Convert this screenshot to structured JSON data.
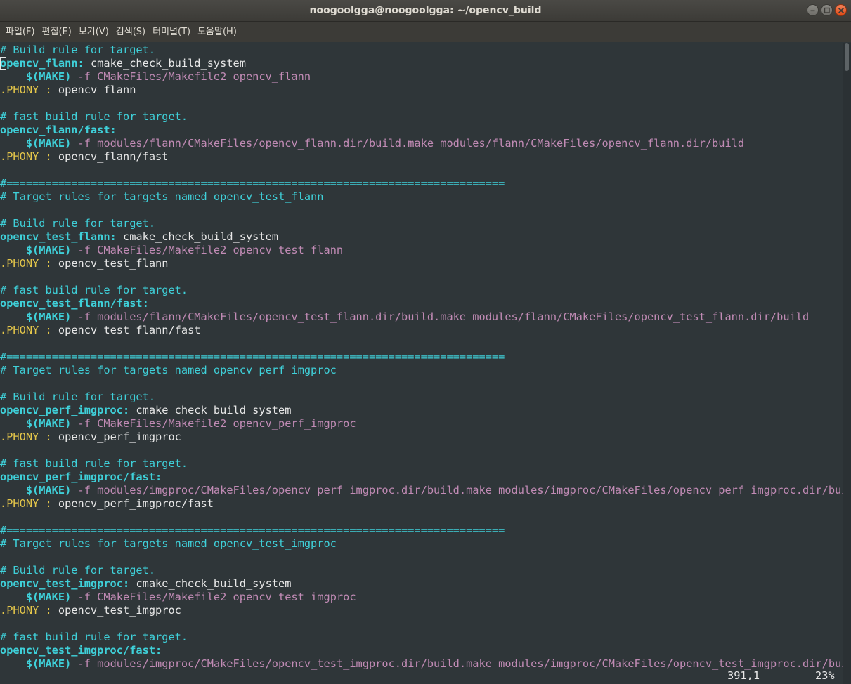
{
  "window": {
    "title": "noogoolgga@noogoolgga: ~/opencv_build"
  },
  "menu": [
    "파일(F)",
    "편집(E)",
    "보기(V)",
    "검색(S)",
    "터미널(T)",
    "도움말(H)"
  ],
  "lines": [
    [
      {
        "t": "# Build rule for target.",
        "c": "comment"
      }
    ],
    [
      {
        "t": "o",
        "c": "target",
        "cursor": true
      },
      {
        "t": "pencv_flann:",
        "c": "target"
      },
      {
        "t": " cmake_check_build_system",
        "c": "plain"
      }
    ],
    [
      {
        "t": "    ",
        "c": "plain"
      },
      {
        "t": "$(MAKE)",
        "c": "make"
      },
      {
        "t": " -f CMakeFiles/Makefile2 opencv_flann",
        "c": "args"
      }
    ],
    [
      {
        "t": ".PHONY",
        "c": "phony"
      },
      {
        "t": " ",
        "c": "plain"
      },
      {
        "t": ":",
        "c": "phony"
      },
      {
        "t": " opencv_flann",
        "c": "plain"
      }
    ],
    [],
    [
      {
        "t": "# fast build rule for target.",
        "c": "comment"
      }
    ],
    [
      {
        "t": "opencv_flann/fast:",
        "c": "target"
      }
    ],
    [
      {
        "t": "    ",
        "c": "plain"
      },
      {
        "t": "$(MAKE)",
        "c": "make"
      },
      {
        "t": " -f modules/flann/CMakeFiles/opencv_flann.dir/build.make modules/flann/CMakeFiles/opencv_flann.dir/build",
        "c": "args"
      }
    ],
    [
      {
        "t": ".PHONY",
        "c": "phony"
      },
      {
        "t": " ",
        "c": "plain"
      },
      {
        "t": ":",
        "c": "phony"
      },
      {
        "t": " opencv_flann/fast",
        "c": "plain"
      }
    ],
    [],
    [
      {
        "t": "#=============================================================================",
        "c": "comment"
      }
    ],
    [
      {
        "t": "# Target rules for targets named opencv_test_flann",
        "c": "comment"
      }
    ],
    [],
    [
      {
        "t": "# Build rule for target.",
        "c": "comment"
      }
    ],
    [
      {
        "t": "opencv_test_flann:",
        "c": "target"
      },
      {
        "t": " cmake_check_build_system",
        "c": "plain"
      }
    ],
    [
      {
        "t": "    ",
        "c": "plain"
      },
      {
        "t": "$(MAKE)",
        "c": "make"
      },
      {
        "t": " -f CMakeFiles/Makefile2 opencv_test_flann",
        "c": "args"
      }
    ],
    [
      {
        "t": ".PHONY",
        "c": "phony"
      },
      {
        "t": " ",
        "c": "plain"
      },
      {
        "t": ":",
        "c": "phony"
      },
      {
        "t": " opencv_test_flann",
        "c": "plain"
      }
    ],
    [],
    [
      {
        "t": "# fast build rule for target.",
        "c": "comment"
      }
    ],
    [
      {
        "t": "opencv_test_flann/fast:",
        "c": "target"
      }
    ],
    [
      {
        "t": "    ",
        "c": "plain"
      },
      {
        "t": "$(MAKE)",
        "c": "make"
      },
      {
        "t": " -f modules/flann/CMakeFiles/opencv_test_flann.dir/build.make modules/flann/CMakeFiles/opencv_test_flann.dir/build",
        "c": "args"
      }
    ],
    [
      {
        "t": ".PHONY",
        "c": "phony"
      },
      {
        "t": " ",
        "c": "plain"
      },
      {
        "t": ":",
        "c": "phony"
      },
      {
        "t": " opencv_test_flann/fast",
        "c": "plain"
      }
    ],
    [],
    [
      {
        "t": "#=============================================================================",
        "c": "comment"
      }
    ],
    [
      {
        "t": "# Target rules for targets named opencv_perf_imgproc",
        "c": "comment"
      }
    ],
    [],
    [
      {
        "t": "# Build rule for target.",
        "c": "comment"
      }
    ],
    [
      {
        "t": "opencv_perf_imgproc:",
        "c": "target"
      },
      {
        "t": " cmake_check_build_system",
        "c": "plain"
      }
    ],
    [
      {
        "t": "    ",
        "c": "plain"
      },
      {
        "t": "$(MAKE)",
        "c": "make"
      },
      {
        "t": " -f CMakeFiles/Makefile2 opencv_perf_imgproc",
        "c": "args"
      }
    ],
    [
      {
        "t": ".PHONY",
        "c": "phony"
      },
      {
        "t": " ",
        "c": "plain"
      },
      {
        "t": ":",
        "c": "phony"
      },
      {
        "t": " opencv_perf_imgproc",
        "c": "plain"
      }
    ],
    [],
    [
      {
        "t": "# fast build rule for target.",
        "c": "comment"
      }
    ],
    [
      {
        "t": "opencv_perf_imgproc/fast:",
        "c": "target"
      }
    ],
    [
      {
        "t": "    ",
        "c": "plain"
      },
      {
        "t": "$(MAKE)",
        "c": "make"
      },
      {
        "t": " -f modules/imgproc/CMakeFiles/opencv_perf_imgproc.dir/build.make modules/imgproc/CMakeFiles/opencv_perf_imgproc.dir/build",
        "c": "args"
      }
    ],
    [
      {
        "t": ".PHONY",
        "c": "phony"
      },
      {
        "t": " ",
        "c": "plain"
      },
      {
        "t": ":",
        "c": "phony"
      },
      {
        "t": " opencv_perf_imgproc/fast",
        "c": "plain"
      }
    ],
    [],
    [
      {
        "t": "#=============================================================================",
        "c": "comment"
      }
    ],
    [
      {
        "t": "# Target rules for targets named opencv_test_imgproc",
        "c": "comment"
      }
    ],
    [],
    [
      {
        "t": "# Build rule for target.",
        "c": "comment"
      }
    ],
    [
      {
        "t": "opencv_test_imgproc:",
        "c": "target"
      },
      {
        "t": " cmake_check_build_system",
        "c": "plain"
      }
    ],
    [
      {
        "t": "    ",
        "c": "plain"
      },
      {
        "t": "$(MAKE)",
        "c": "make"
      },
      {
        "t": " -f CMakeFiles/Makefile2 opencv_test_imgproc",
        "c": "args"
      }
    ],
    [
      {
        "t": ".PHONY",
        "c": "phony"
      },
      {
        "t": " ",
        "c": "plain"
      },
      {
        "t": ":",
        "c": "phony"
      },
      {
        "t": " opencv_test_imgproc",
        "c": "plain"
      }
    ],
    [],
    [
      {
        "t": "# fast build rule for target.",
        "c": "comment"
      }
    ],
    [
      {
        "t": "opencv_test_imgproc/fast:",
        "c": "target"
      }
    ],
    [
      {
        "t": "    ",
        "c": "plain"
      },
      {
        "t": "$(MAKE)",
        "c": "make"
      },
      {
        "t": " -f modules/imgproc/CMakeFiles/opencv_test_imgproc.dir/build.make modules/imgproc/CMakeFiles/opencv_test_imgproc.dir/build",
        "c": "args"
      }
    ]
  ],
  "status": {
    "position": "391,1",
    "percent": "23%"
  },
  "colors": {
    "background": "#2f3639",
    "comment": "#3fd0d9",
    "args": "#c18bb5",
    "phony": "#e4c64a",
    "plain": "#e8e8e8"
  },
  "icons": {
    "minimize": "minimize-icon",
    "maximize": "maximize-icon",
    "close": "close-icon"
  }
}
